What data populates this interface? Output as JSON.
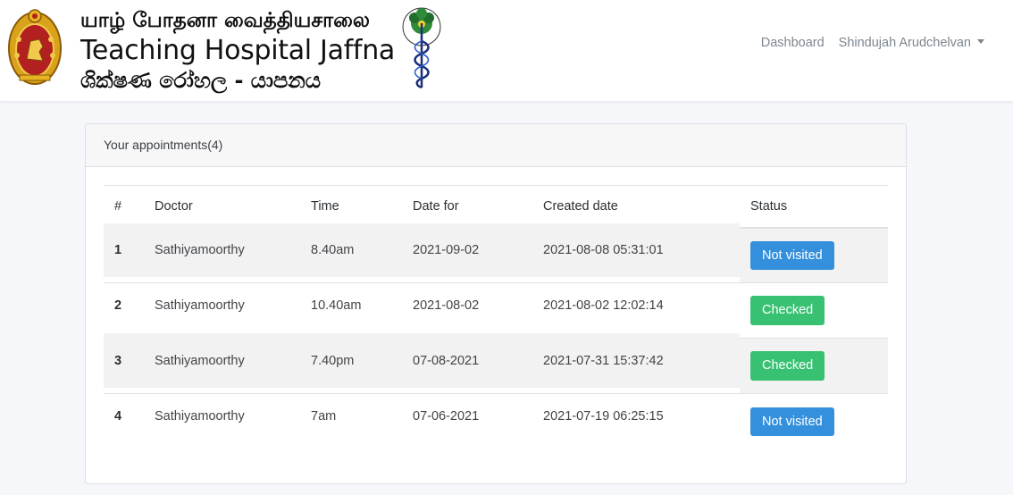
{
  "brand": {
    "tamil_name": "யாழ் போதனா வைத்தியசாலை",
    "english_name": "Teaching Hospital Jaffna",
    "sinhala_name": "ශික්ෂණ රෝහල - යාපනය",
    "emblem_icon": "sri-lanka-emblem-icon",
    "logo_icon": "hospital-caduceus-logo-icon"
  },
  "nav": {
    "dashboard": "Dashboard",
    "user": "Shindujah Arudchelvan"
  },
  "appointments": {
    "title": "Your appointments(4)",
    "columns": [
      "#",
      "Doctor",
      "Time",
      "Date for",
      "Created date",
      "Status"
    ],
    "rows": [
      {
        "num": "1",
        "doctor": "Sathiyamoorthy",
        "time": "8.40am",
        "date_for": "2021-09-02",
        "created": "2021-08-08 05:31:01",
        "status": "Not visited",
        "status_color": "#3490dc"
      },
      {
        "num": "2",
        "doctor": "Sathiyamoorthy",
        "time": "10.40am",
        "date_for": "2021-08-02",
        "created": "2021-08-02 12:02:14",
        "status": "Checked",
        "status_color": "#38c172"
      },
      {
        "num": "3",
        "doctor": "Sathiyamoorthy",
        "time": "7.40pm",
        "date_for": "07-08-2021",
        "created": "2021-07-31 15:37:42",
        "status": "Checked",
        "status_color": "#38c172"
      },
      {
        "num": "4",
        "doctor": "Sathiyamoorthy",
        "time": "7am",
        "date_for": "07-06-2021",
        "created": "2021-07-19 06:25:15",
        "status": "Not visited",
        "status_color": "#3490dc"
      }
    ]
  }
}
